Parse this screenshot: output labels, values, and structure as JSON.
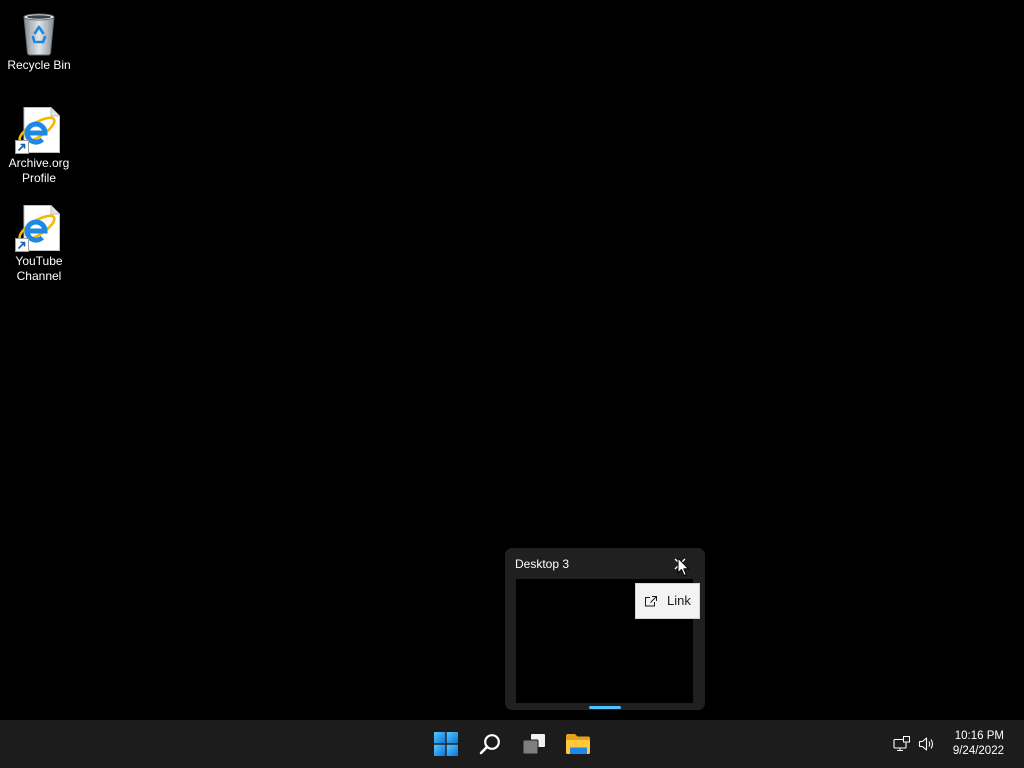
{
  "colors": {
    "desktop_background": "#000000",
    "taskbar_background": "#1c1c1c",
    "flyout_background": "#202020",
    "accent": "#4cc2ff"
  },
  "desktop": {
    "icons": [
      {
        "label": "Recycle Bin",
        "icon": "recycle-bin-icon"
      },
      {
        "label": "Archive.org Profile",
        "icon": "internet-explorer-shortcut-icon"
      },
      {
        "label": "YouTube Channel",
        "icon": "internet-explorer-shortcut-icon"
      }
    ]
  },
  "task_view_flyout": {
    "title": "Desktop 3",
    "close_icon": "close-icon",
    "tooltip": {
      "label": "Link",
      "icon": "link-icon"
    }
  },
  "taskbar": {
    "pinned_icons": [
      "windows-logo-icon",
      "search-icon",
      "task-view-icon",
      "file-explorer-icon"
    ],
    "tray_icons": [
      "network-icon",
      "volume-icon"
    ],
    "clock": {
      "time": "10:16 PM",
      "date": "9/24/2022"
    }
  }
}
